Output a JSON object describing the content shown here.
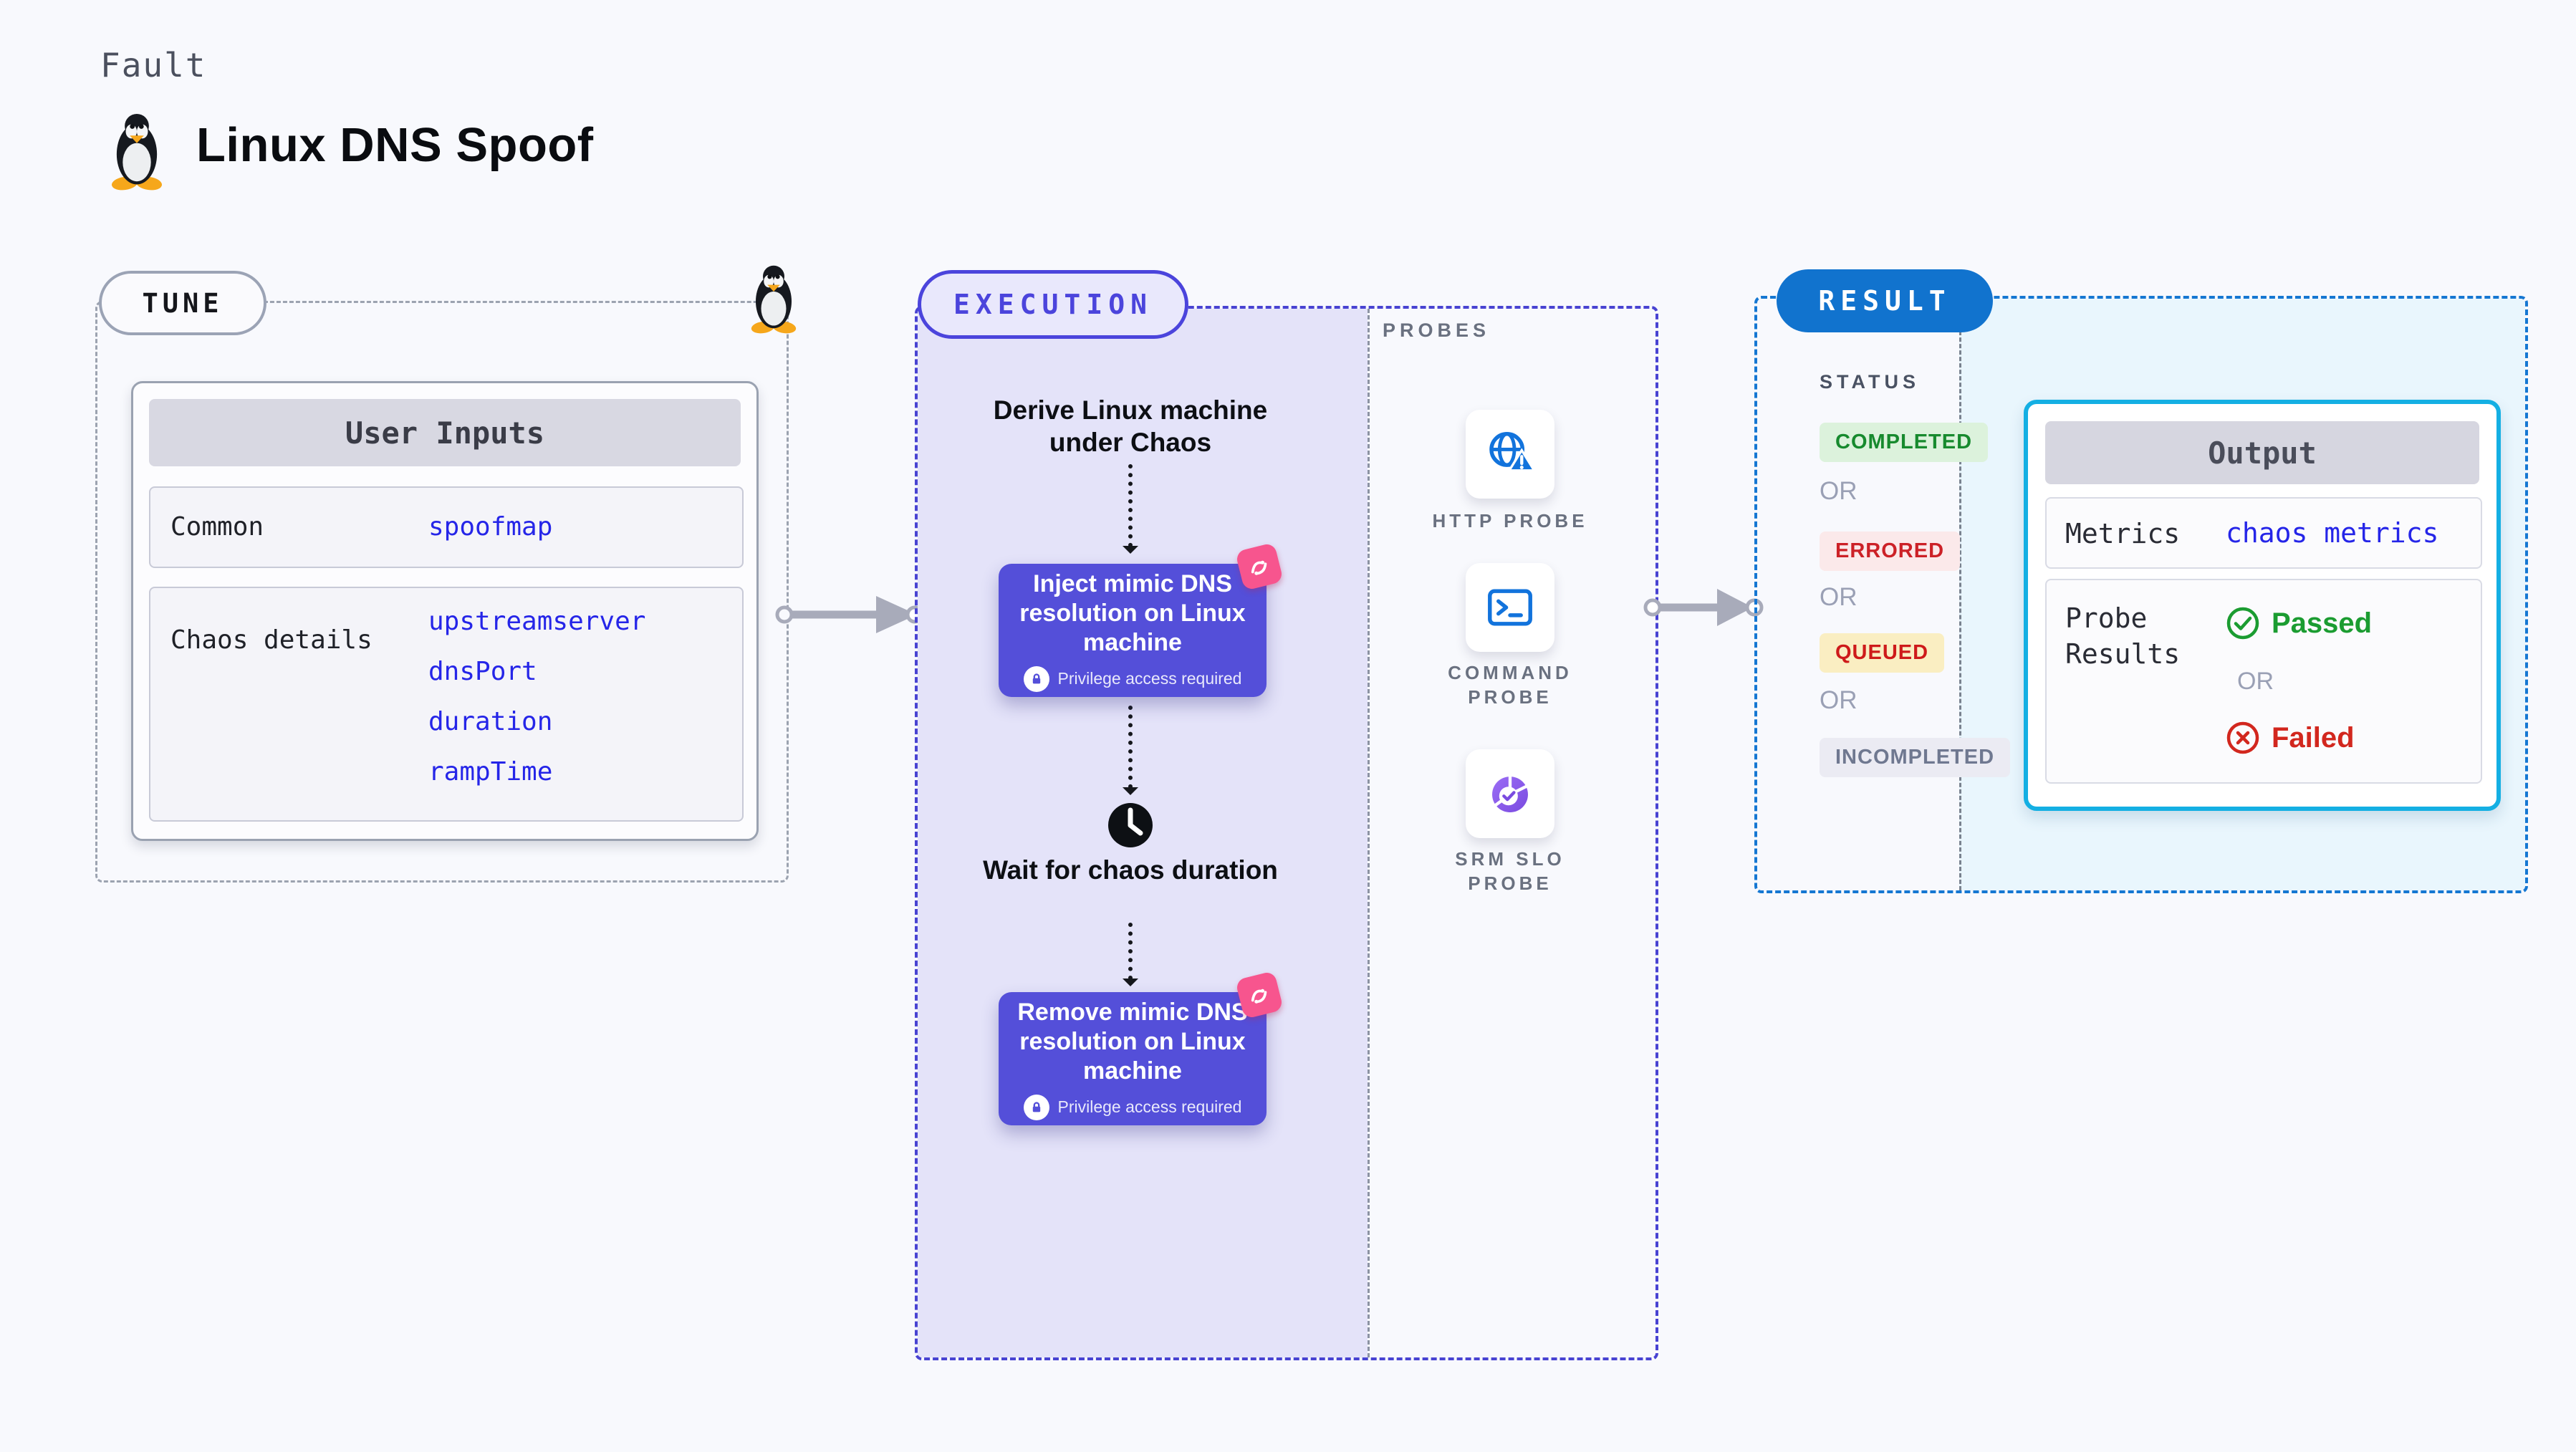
{
  "header": {
    "eyebrow": "Fault",
    "title": "Linux DNS Spoof",
    "icon": "tux-penguin-icon"
  },
  "tune": {
    "label": "TUNE",
    "card_title": "User Inputs",
    "rows": [
      {
        "label": "Common",
        "values": [
          "spoofmap"
        ]
      },
      {
        "label": "Chaos details",
        "values": [
          "upstreamserver",
          "dnsPort",
          "duration",
          "rampTime"
        ]
      }
    ]
  },
  "execution": {
    "label": "EXECUTION",
    "steps": {
      "derive": "Derive Linux machine under Chaos",
      "inject": "Inject mimic DNS resolution on Linux machine",
      "wait": "Wait for chaos duration",
      "remove": "Remove mimic DNS resolution on Linux machine",
      "privilege_note": "Privilege access required"
    }
  },
  "probes": {
    "label": "PROBES",
    "items": [
      {
        "name": "HTTP PROBE",
        "icon": "globe-alert-icon"
      },
      {
        "name": "COMMAND PROBE",
        "icon": "terminal-icon"
      },
      {
        "name": "SRM SLO PROBE",
        "icon": "slo-pie-check-icon"
      }
    ]
  },
  "result": {
    "label": "RESULT",
    "status_heading": "STATUS",
    "or_label": "OR",
    "statuses": [
      {
        "label": "COMPLETED",
        "text_color": "#178A2E",
        "bg_color": "#DCF2DC"
      },
      {
        "label": "ERRORED",
        "text_color": "#CC2127",
        "bg_color": "#FBE9EA"
      },
      {
        "label": "QUEUED",
        "text_color": "#CE1A1A",
        "bg_color": "#FAEEC2"
      },
      {
        "label": "INCOMPLETED",
        "text_color": "#6F7890",
        "bg_color": "#EBEBF3"
      }
    ],
    "output": {
      "title": "Output",
      "metrics_label": "Metrics",
      "metrics_value": "chaos metrics",
      "probe_results_label": "Probe Results",
      "passed_label": "Passed",
      "failed_label": "Failed"
    }
  },
  "colors": {
    "page_bg": "#F8F9FD",
    "tune_dash": "#9CA3B0",
    "execution_accent": "#4B44DC",
    "execution_panel": "#E4E3F9",
    "result_accent": "#1577D2",
    "result_panel": "#E9F6FD",
    "output_border": "#14AFE3",
    "chaos_node": "#544FD9",
    "badge_pink": "#F7558E",
    "value_blue": "#2525E8",
    "probe_icon_blue": "#1273DC",
    "passed_green": "#1B9C31",
    "failed_red": "#D2271E",
    "arrow_gray": "#A8ABBA"
  }
}
